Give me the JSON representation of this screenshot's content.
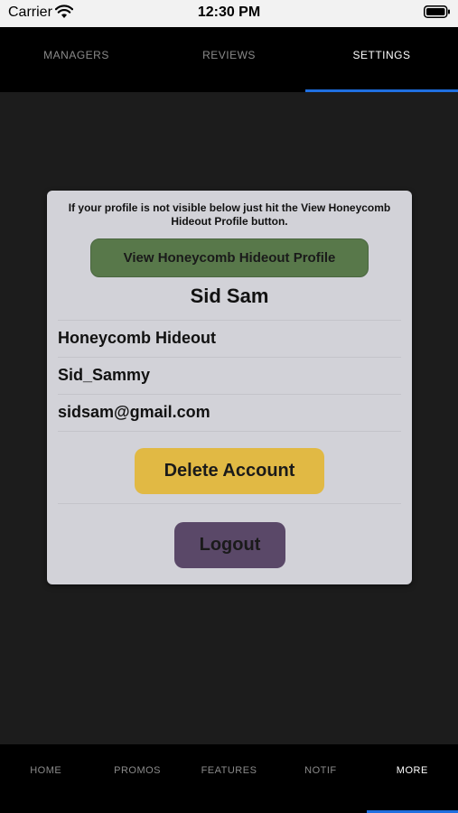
{
  "status_bar": {
    "carrier": "Carrier",
    "time": "12:30 PM",
    "wifi_icon": "wifi-icon",
    "battery_icon": "battery-icon"
  },
  "top_tabs": [
    {
      "label": "MANAGERS",
      "active": false
    },
    {
      "label": "REVIEWS",
      "active": false
    },
    {
      "label": "SETTINGS",
      "active": true
    }
  ],
  "card": {
    "info_text": "If your profile is not visible below just hit the View Honeycomb Hideout Profile button.",
    "view_profile_label": "View Honeycomb Hideout Profile",
    "name": "Sid Sam",
    "fields": [
      "Honeycomb Hideout",
      "Sid_Sammy",
      "sidsam@gmail.com"
    ],
    "delete_label": "Delete Account",
    "logout_label": "Logout"
  },
  "bottom_tabs": [
    {
      "label": "HOME",
      "active": false
    },
    {
      "label": "PROMOS",
      "active": false
    },
    {
      "label": "FEATURES",
      "active": false
    },
    {
      "label": "NOTIF",
      "active": false
    },
    {
      "label": "MORE",
      "active": true
    }
  ],
  "colors": {
    "accent": "#1f6fe0",
    "view_profile_button": "#58784a",
    "delete_button": "#e1b944",
    "logout_button": "#5a4868",
    "card_background": "#d2d2d8",
    "screen_background": "#1c1c1c"
  }
}
